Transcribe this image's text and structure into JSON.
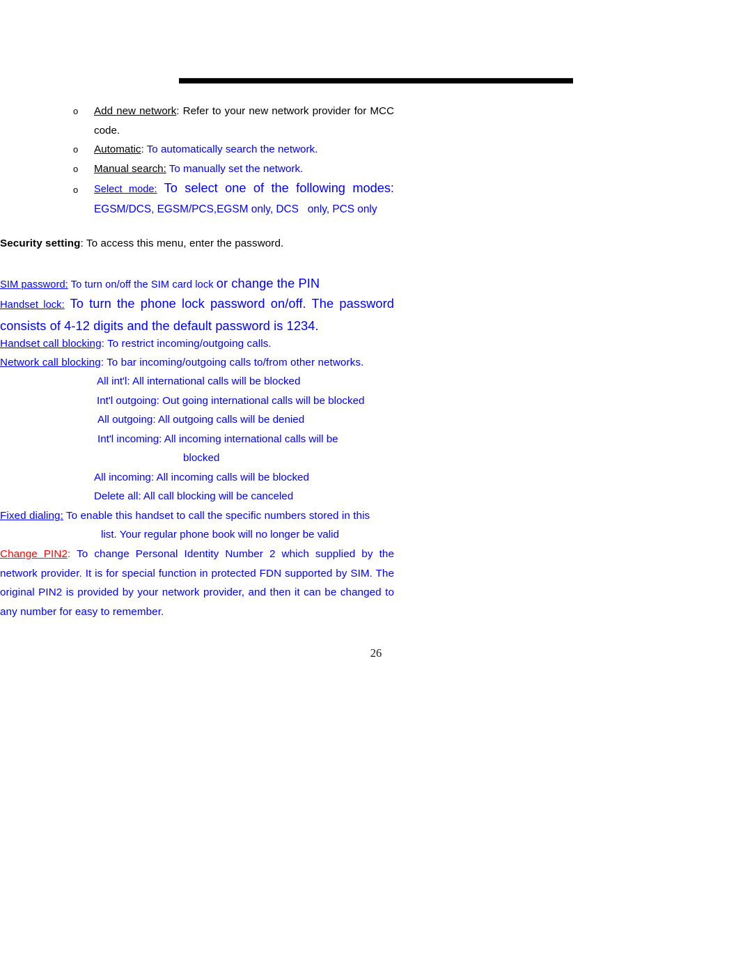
{
  "document": {
    "page_number": "26",
    "colors": {
      "body_text": "#000000",
      "highlight_blue": "#0000ff",
      "highlight_red": "#ff0000"
    }
  },
  "network_section": {
    "bullets": [
      {
        "marker": "o",
        "label": "Add new network",
        "separator": ": ",
        "description": "Refer to your new network provider for MCC code."
      },
      {
        "marker": "o",
        "label": "Automatic",
        "separator": ": ",
        "description": "To automatically search the network."
      },
      {
        "marker": "o",
        "label": "Manual search:",
        "separator": " ",
        "description": "To manually set the network."
      },
      {
        "marker": "o",
        "label": "Select mode:",
        "separator": " ",
        "description": "To select one of the following modes:",
        "modes": "EGSM/DCS, EGSM/PCS,EGSM only, DCS   only, PCS only"
      }
    ]
  },
  "security_section": {
    "heading_label": "Security setting",
    "heading_rest": ": To access this menu, enter the password.",
    "entries": [
      {
        "label": "SIM password:",
        "text_small": " To turn on/off the SIM card lock ",
        "text_large": "or change the PIN"
      },
      {
        "label": "Handset lock:",
        "text_large": " To turn the phone lock password on/off.   The password consists of 4-12 digits and the default password is 1234."
      },
      {
        "label": "Handset call blocking",
        "text": ": To restrict incoming/outgoing calls."
      },
      {
        "label": "Network call blocking",
        "text": ": To bar incoming/outgoing calls to/from other networks."
      }
    ],
    "call_blocking_options": [
      {
        "text": "All int'l: All international calls will be blocked",
        "indent": 139
      },
      {
        "text": "Int'l outgoing: Out going international calls will be blocked",
        "indent": 139
      },
      {
        "text": "All outgoing: All outgoing calls will be denied",
        "indent": 140
      },
      {
        "text": "Int'l incoming: All incoming international calls will be",
        "indent": 140
      },
      {
        "text": "blocked",
        "indent": 263
      },
      {
        "text": "All incoming: All incoming calls will be blocked",
        "indent": 135
      },
      {
        "text": "Delete all: All call blocking will be canceled",
        "indent": 135
      }
    ],
    "fixed_dialing": {
      "label": "Fixed dialing:",
      "line1": " To enable this handset to call the specific numbers stored in this",
      "line2": "list. Your regular phone book will no longer be valid"
    },
    "change_pin2": {
      "label": "Change PIN2",
      "colon": ":",
      "text": " To change Personal Identity Number 2 which supplied by the network provider. It is for special function in protected FDN supported by SIM. The original PIN2 is provided by your network provider, and then it can be changed to any number for easy to remember."
    }
  }
}
